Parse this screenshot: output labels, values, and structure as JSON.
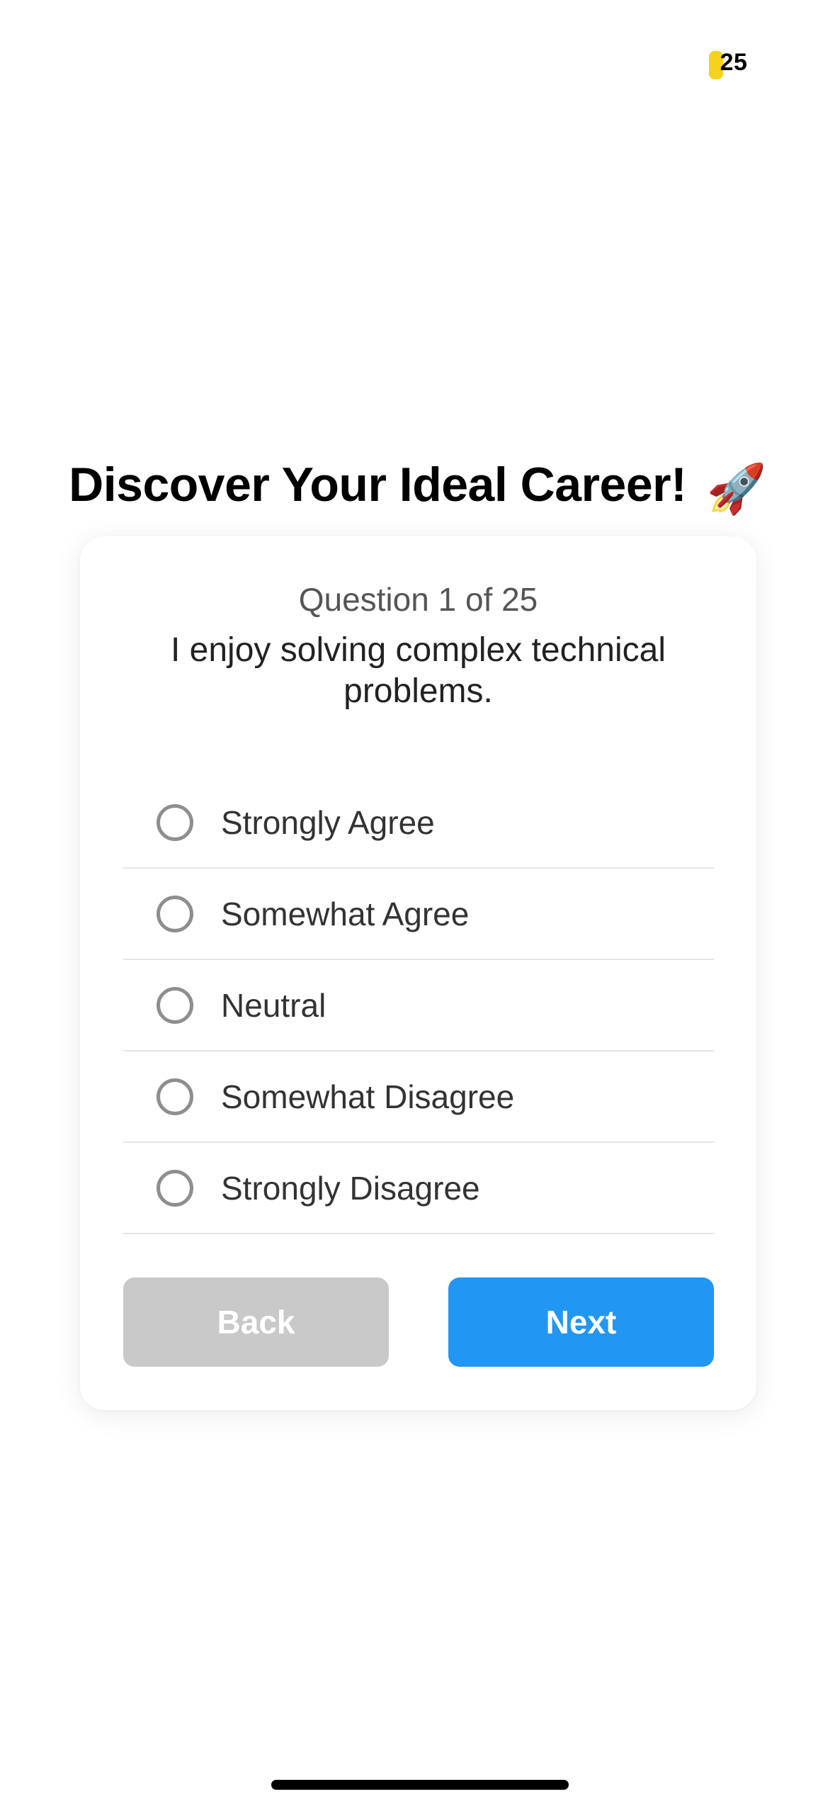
{
  "status_bar": {
    "battery_level": "25",
    "battery_fraction": 0.25,
    "battery_color": "#F7D21A"
  },
  "header": {
    "title": "Discover Your Ideal Career!",
    "title_emoji": "🚀"
  },
  "quiz": {
    "counter": "Question 1 of 25",
    "question": "I enjoy solving complex technical problems.",
    "options": [
      {
        "label": "Strongly Agree",
        "selected": false
      },
      {
        "label": "Somewhat Agree",
        "selected": false
      },
      {
        "label": "Neutral",
        "selected": false
      },
      {
        "label": "Somewhat Disagree",
        "selected": false
      },
      {
        "label": "Strongly Disagree",
        "selected": false
      }
    ],
    "back_label": "Back",
    "next_label": "Next"
  },
  "colors": {
    "primary": "#2196F3",
    "disabled": "#C9C9C9",
    "radio_border": "#8E8E8E"
  }
}
